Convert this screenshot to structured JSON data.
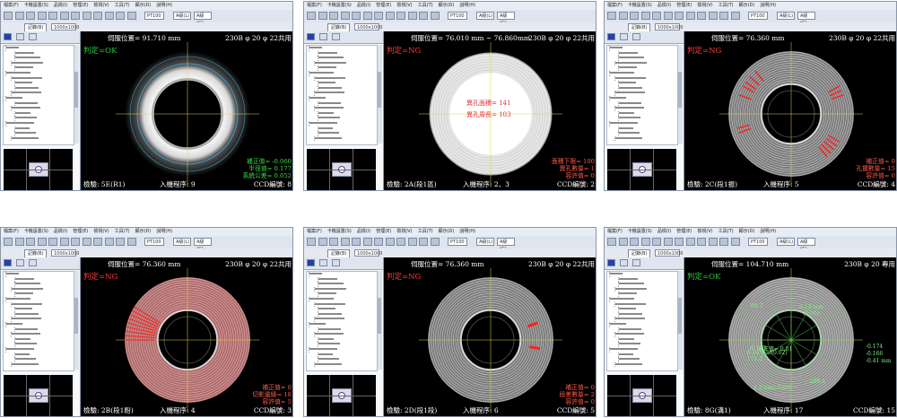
{
  "app": {
    "menu_items": [
      "檔案(F)",
      "卡機設置(S)",
      "品檢(I)",
      "管理(E)",
      "檢視(V)",
      "工具(T)",
      "顯示(D)",
      "說明(H)"
    ],
    "toolbar_field_text": "PT100",
    "toolbar_field_text2": "A級(L)",
    "toolbar_field_text3": "A級(G)",
    "tab_label": "記錄(B)",
    "tab_field": "1000x1000"
  },
  "panels": [
    {
      "position_label": "伺服位置= 91.710 mm",
      "model_label": "230B φ 20 φ 22共用",
      "judge": "判定=OK",
      "judge_state": "ok",
      "footer_step": "檢驗: 5E(R1)",
      "footer_program": "入機程序: 9",
      "footer_ccd": "CCD編號: 8",
      "measurements": [
        {
          "label": "補正值= -0.060",
          "color": "green"
        },
        {
          "label": "半徑值= 0.177",
          "color": "green"
        },
        {
          "label": "系統公差= 0.052",
          "color": "green"
        }
      ],
      "center_texts": []
    },
    {
      "position_label": "伺服位置= 76.010 mm ~ 76.860mm",
      "model_label": "230B φ 20 φ 22共用",
      "judge": "判定=NG",
      "judge_state": "ng",
      "footer_step": "檢驗: 2A(段1區)",
      "footer_program": "入機程序: 2、3",
      "footer_ccd": "CCD編號: 2",
      "measurements": [
        {
          "label": "面積下限= 100",
          "color": "red"
        },
        {
          "label": "異孔數量= 1",
          "color": "red"
        },
        {
          "label": "容許值= 0",
          "color": "red"
        }
      ],
      "center_texts": [
        "異孔面積= 141",
        "異孔周長= 103"
      ]
    },
    {
      "position_label": "伺服位置= 76.360 mm",
      "model_label": "230B φ 20 φ 22共用",
      "judge": "判定=NG",
      "judge_state": "ng",
      "footer_step": "檢驗: 2C(段1振)",
      "footer_program": "入機程序: 5",
      "footer_ccd": "CCD編號: 4",
      "measurements": [
        {
          "label": "補正值= 0",
          "color": "red"
        },
        {
          "label": "孔擴數量= 15",
          "color": "red"
        },
        {
          "label": "容許值= 0",
          "color": "red"
        }
      ],
      "center_texts": []
    },
    {
      "position_label": "伺服位置= 76.360 mm",
      "model_label": "230B φ 20 φ 22共用",
      "judge": "判定=NG",
      "judge_state": "ng",
      "footer_step": "檢驗: 2B(段1粉)",
      "footer_program": "入機程序: 4",
      "footer_ccd": "CCD編號: 3",
      "measurements": [
        {
          "label": "補正值= 0",
          "color": "red"
        },
        {
          "label": "切影邊緣= 18",
          "color": "red"
        },
        {
          "label": "容許值= 5",
          "color": "red"
        }
      ],
      "center_texts": []
    },
    {
      "position_label": "伺服位置= 76.360 mm",
      "model_label": "230B φ 20 φ 22共用",
      "judge": "判定=NG",
      "judge_state": "ng",
      "footer_step": "檢驗: 2D(段1段)",
      "footer_program": "入機程序: 6",
      "footer_ccd": "CCD編號: 5",
      "measurements": [
        {
          "label": "補正值= 0",
          "color": "red"
        },
        {
          "label": "段差數量= 2",
          "color": "red"
        },
        {
          "label": "容許值= 0",
          "color": "red"
        }
      ],
      "center_texts": []
    },
    {
      "position_label": "伺服位置= 104.710 mm",
      "model_label": "230B φ 20 專用",
      "judge": "判定=OK",
      "judge_state": "ok",
      "footer_step": "檢驗: 8G(溝1)",
      "footer_program": "入機程序: 17",
      "footer_ccd": "CCD編號: 15",
      "measurements": [],
      "center_texts": [
        "0.13 mm",
        "(0.16)",
        "84.7",
        "補正值= 0.01",
        "6.64 mm(0.02)",
        "171.2",
        "-0.193",
        "-0.174",
        "-0.166",
        "-0.41 mm",
        "208.4",
        "4.2 mm(-0.05)"
      ]
    }
  ],
  "colors": {
    "ok": "#2ecc40",
    "ng": "#ff3b3b",
    "panel_bg": "#c9d3e3",
    "viewer_bg": "#000000"
  }
}
